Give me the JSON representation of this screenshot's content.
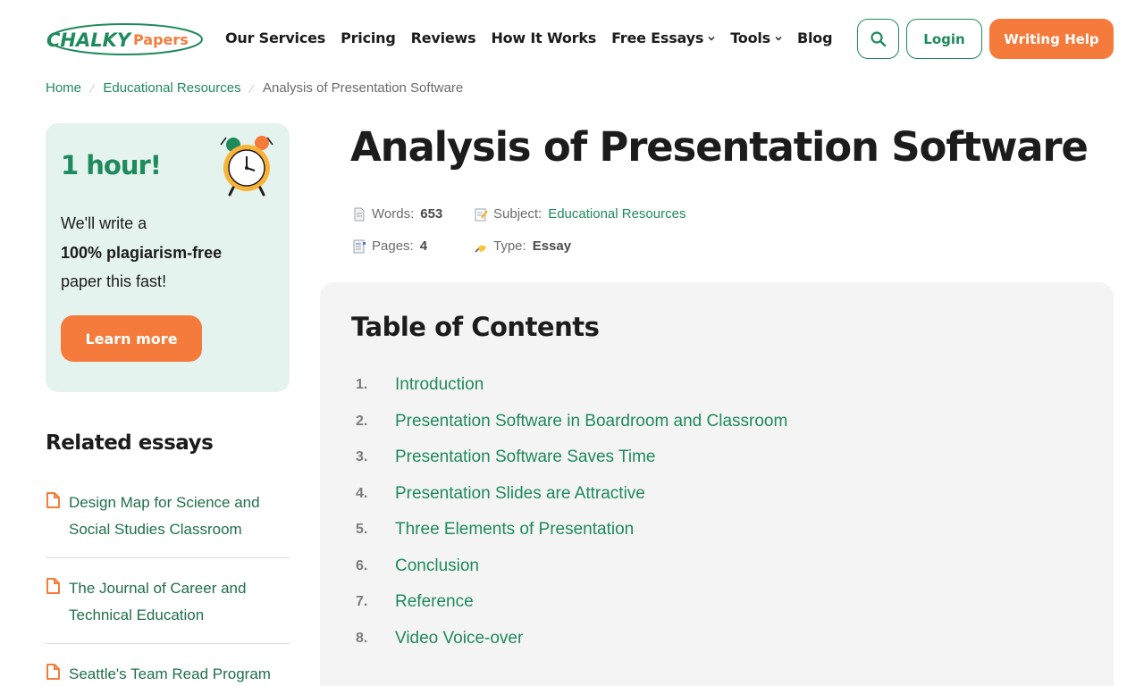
{
  "header": {
    "logo_text_main": "CHALKY",
    "logo_text_sub": "Papers",
    "nav": [
      {
        "label": "Our Services",
        "dropdown": false
      },
      {
        "label": "Pricing",
        "dropdown": false
      },
      {
        "label": "Reviews",
        "dropdown": false
      },
      {
        "label": "How It Works",
        "dropdown": false
      },
      {
        "label": "Free Essays",
        "dropdown": true
      },
      {
        "label": "Tools",
        "dropdown": true
      },
      {
        "label": "Blog",
        "dropdown": false
      }
    ],
    "search_icon": "search-icon",
    "login_label": "Login",
    "writing_help_label": "Writing Help"
  },
  "breadcrumb": {
    "items": [
      "Home",
      "Educational Resources"
    ],
    "current": "Analysis of Presentation Software"
  },
  "promo": {
    "title": "1 hour!",
    "text_before": "We'll write a",
    "text_bold": "100% plagiarism-free",
    "text_after": "paper this fast!",
    "button_label": "Learn more",
    "icon": "alarm-clock-icon"
  },
  "related": {
    "title": "Related essays",
    "items": [
      "Design Map for Science and Social Studies Classroom",
      "The Journal of Career and Technical Education",
      "Seattle's Team Read Program"
    ]
  },
  "article": {
    "title": "Analysis of Presentation Software",
    "meta": {
      "words_label": "Words:",
      "words_value": "653",
      "subject_label": "Subject:",
      "subject_value": "Educational Resources",
      "pages_label": "Pages:",
      "pages_value": "4",
      "type_label": "Type:",
      "type_value": "Essay"
    }
  },
  "toc": {
    "title": "Table of Contents",
    "items": [
      {
        "num": "1.",
        "label": "Introduction"
      },
      {
        "num": "2.",
        "label": "Presentation Software in Boardroom and Classroom"
      },
      {
        "num": "3.",
        "label": "Presentation Software Saves Time"
      },
      {
        "num": "4.",
        "label": "Presentation Slides are Attractive"
      },
      {
        "num": "5.",
        "label": "Three Elements of Presentation"
      },
      {
        "num": "6.",
        "label": "Conclusion"
      },
      {
        "num": "7.",
        "label": "Reference"
      },
      {
        "num": "8.",
        "label": "Video Voice-over"
      }
    ]
  },
  "colors": {
    "brand_green": "#1f8a5c",
    "accent_orange": "#f47b3b",
    "promo_bg": "#e5f3ef",
    "toc_bg": "#f4f4f4"
  }
}
